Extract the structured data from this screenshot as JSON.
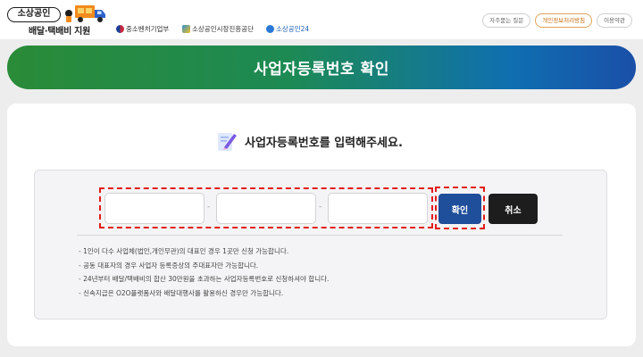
{
  "header": {
    "logo_badge": "소상공인",
    "logo_sub": "배달·택배비 지원",
    "partners": [
      "중소벤처기업부",
      "소상공인시장진흥공단",
      "소상공인24"
    ],
    "top_links": [
      "자주묻는 질문",
      "개인정보처리방침",
      "이용약관"
    ]
  },
  "banner": {
    "title": "사업자등록번호 확인"
  },
  "form": {
    "heading": "사업자등록번호를 입력해주세요.",
    "separator": "-",
    "inputs": [
      {
        "value": ""
      },
      {
        "value": ""
      },
      {
        "value": ""
      }
    ],
    "confirm_label": "확인",
    "cancel_label": "취소"
  },
  "notes": [
    "1인이 다수 사업체(법인,개인무관)의 대표인 경우 1곳만 신청 가능합니다.",
    "공동 대표자의 경우 사업자 등록증상의 주대표자만 가능합니다.",
    "24년부터 배달/택배비의 합산 30만원을 초과하는 사업자등록번호로 신청하셔야 합니다.",
    "신속지급은 O2O플랫폼사와 배달대행사를 활용하신 경우만 가능합니다."
  ],
  "colors": {
    "confirm_button": "#1f4e9a",
    "cancel_button": "#1d1d1d",
    "highlight_outline": "#e21a1a",
    "banner_start": "#2a8b38",
    "banner_end": "#1a4fa8"
  },
  "icons": [
    "truck-logo-icon",
    "edit-document-icon"
  ]
}
